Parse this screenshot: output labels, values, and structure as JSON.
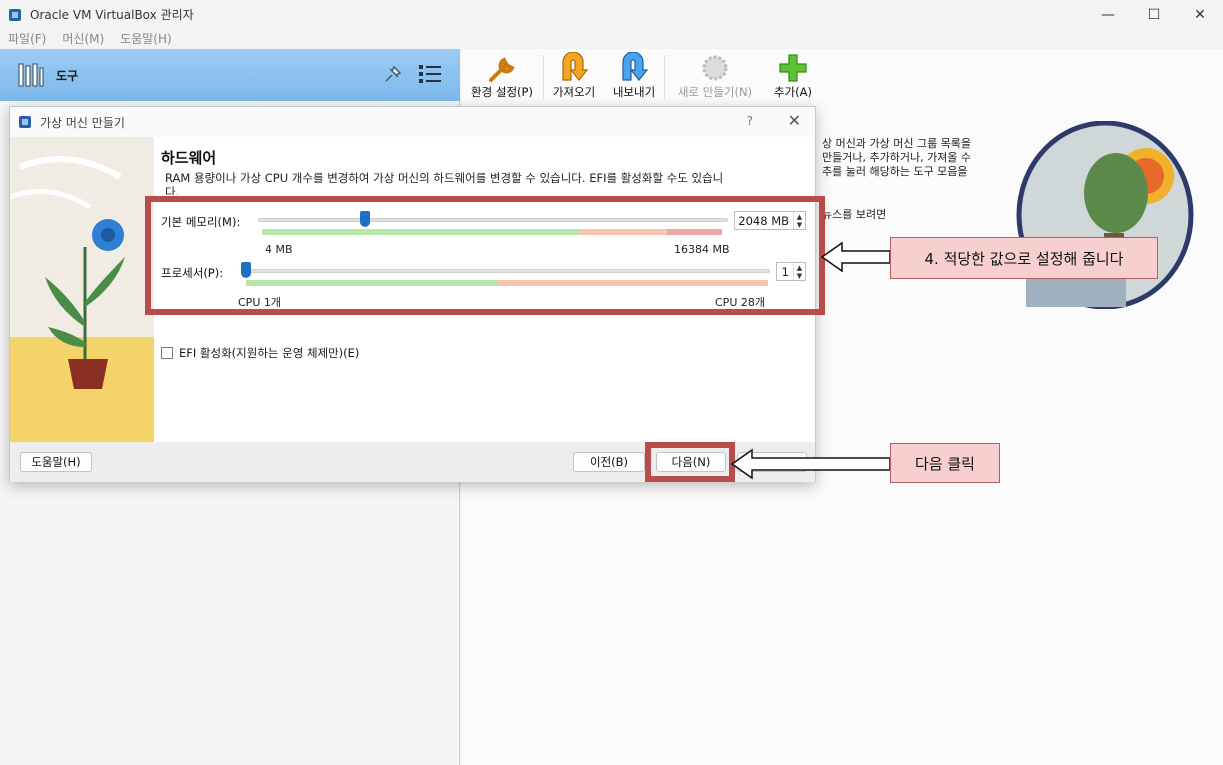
{
  "window": {
    "title": "Oracle VM VirtualBox 관리자",
    "controls": {
      "minimize": "—",
      "maximize": "☐",
      "close": "✕"
    }
  },
  "menu": [
    "파일(F)",
    "머신(M)",
    "도움말(H)"
  ],
  "left": {
    "tools_label": "도구"
  },
  "toolbar": {
    "items": [
      {
        "label": "환경 설정(P)",
        "icon": "wrench-icon",
        "enabled": true
      },
      {
        "label": "가져오기",
        "icon": "import-arrow-icon",
        "enabled": true
      },
      {
        "label": "내보내기",
        "icon": "export-arrow-icon",
        "enabled": true
      },
      {
        "label": "새로 만들기(N)",
        "icon": "new-gear-icon",
        "enabled": false
      },
      {
        "label": "추가(A)",
        "icon": "plus-icon",
        "enabled": true
      }
    ]
  },
  "welcome": {
    "line1": "상 머신과 가상 머신 그룹 목록을",
    "line2": "만들거나, 추가하거나, 가져올 수",
    "line3": "추를 눌러 해당하는 도구 모음을",
    "line4": "뉴스를 보려면"
  },
  "dialog": {
    "title": "가상 머신 만들기",
    "help_glyph": "?",
    "close_glyph": "✕",
    "heading": "하드웨어",
    "description": "RAM 용량이나 가상 CPU 개수를 변경하여 가상 머신의 하드웨어를 변경할 수 있습니다. EFI를 활성화할 수도 있습니다.",
    "memory": {
      "label": "기본 메모리(M):",
      "value": "2048 MB",
      "min_label": "4 MB",
      "max_label": "16384 MB",
      "value_mb": 2048,
      "min_mb": 4,
      "max_mb": 16384
    },
    "processor": {
      "label": "프로세서(P):",
      "value": "1",
      "min_label": "CPU 1개",
      "max_label": "CPU 28개",
      "value_cpu": 1,
      "min_cpu": 1,
      "max_cpu": 28
    },
    "efi": {
      "label": "EFI 활성화(지원하는 운영 체제만)(E)",
      "checked": false
    },
    "buttons": {
      "help": "도움말(H)",
      "back": "이전(B)",
      "next": "다음(N)"
    }
  },
  "annotations": {
    "step4": "4. 적당한 값으로 설정해 줍니다",
    "click_next": "다음 클릭"
  },
  "colors": {
    "tools_blue": "#85bdee",
    "highlight": "#b84c4c",
    "callout_bg": "#f7cfcf",
    "scale_green": "#b7e7a9",
    "scale_red": "#f2b9a6",
    "thumb_blue": "#1f6fc4"
  }
}
